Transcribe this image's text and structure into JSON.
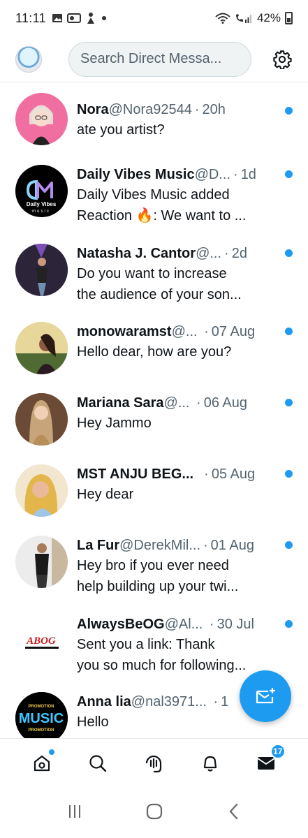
{
  "status_bar": {
    "time": "11:11",
    "battery": "42%"
  },
  "header": {
    "search_placeholder": "Search Direct Messa..."
  },
  "conversations": [
    {
      "name": "Nora",
      "handle": "@Nora92544",
      "time": "20h",
      "message_lines": [
        "ate you artist?"
      ],
      "unread": true
    },
    {
      "name": "Daily Vibes Music",
      "handle": "@D...",
      "time": "1d",
      "message_lines": [
        "Daily Vibes Music added",
        "Reaction 🔥: We want to ..."
      ],
      "unread": true,
      "avatar_text_1": "Daily Vibes",
      "avatar_text_2": "music"
    },
    {
      "name": "Natasha J. Cantor",
      "handle": "@...",
      "time": "2d",
      "message_lines": [
        "Do you want to increase",
        "the audience of your son..."
      ],
      "unread": true
    },
    {
      "name": "monowaramst",
      "handle": "@...",
      "time": "07 Aug",
      "message_lines": [
        "Hello dear, how are you?"
      ],
      "unread": true
    },
    {
      "name": "Mariana Sara",
      "handle": "@...",
      "time": "06 Aug",
      "message_lines": [
        "Hey Jammo"
      ],
      "unread": true
    },
    {
      "name": "MST ANJU BEG...",
      "handle": "",
      "time": "05 Aug",
      "message_lines": [
        "Hey dear"
      ],
      "unread": true
    },
    {
      "name": "La Fur",
      "handle": "@DerekMil...",
      "time": "01 Aug",
      "message_lines": [
        "Hey bro if you ever need",
        "help building up your twi..."
      ],
      "unread": true
    },
    {
      "name": "AlwaysBeOG",
      "handle": "@Al...",
      "time": "30 Jul",
      "message_lines": [
        "Sent you a link: Thank",
        "you so much for following..."
      ],
      "unread": true,
      "avatar_text_1": "ABOG"
    },
    {
      "name": "Anna lia",
      "handle": "@nal3971...",
      "time": "1",
      "message_lines": [
        "Hello"
      ],
      "unread": false,
      "avatar_text_1": "PROMOTION",
      "avatar_text_2": "MUSIC",
      "avatar_text_3": "PROMOTION"
    }
  ],
  "bottom_nav": {
    "messages_badge": "17"
  },
  "colors": {
    "accent": "#1d9bf0",
    "text_primary": "#0f1419",
    "text_secondary": "#536471"
  }
}
